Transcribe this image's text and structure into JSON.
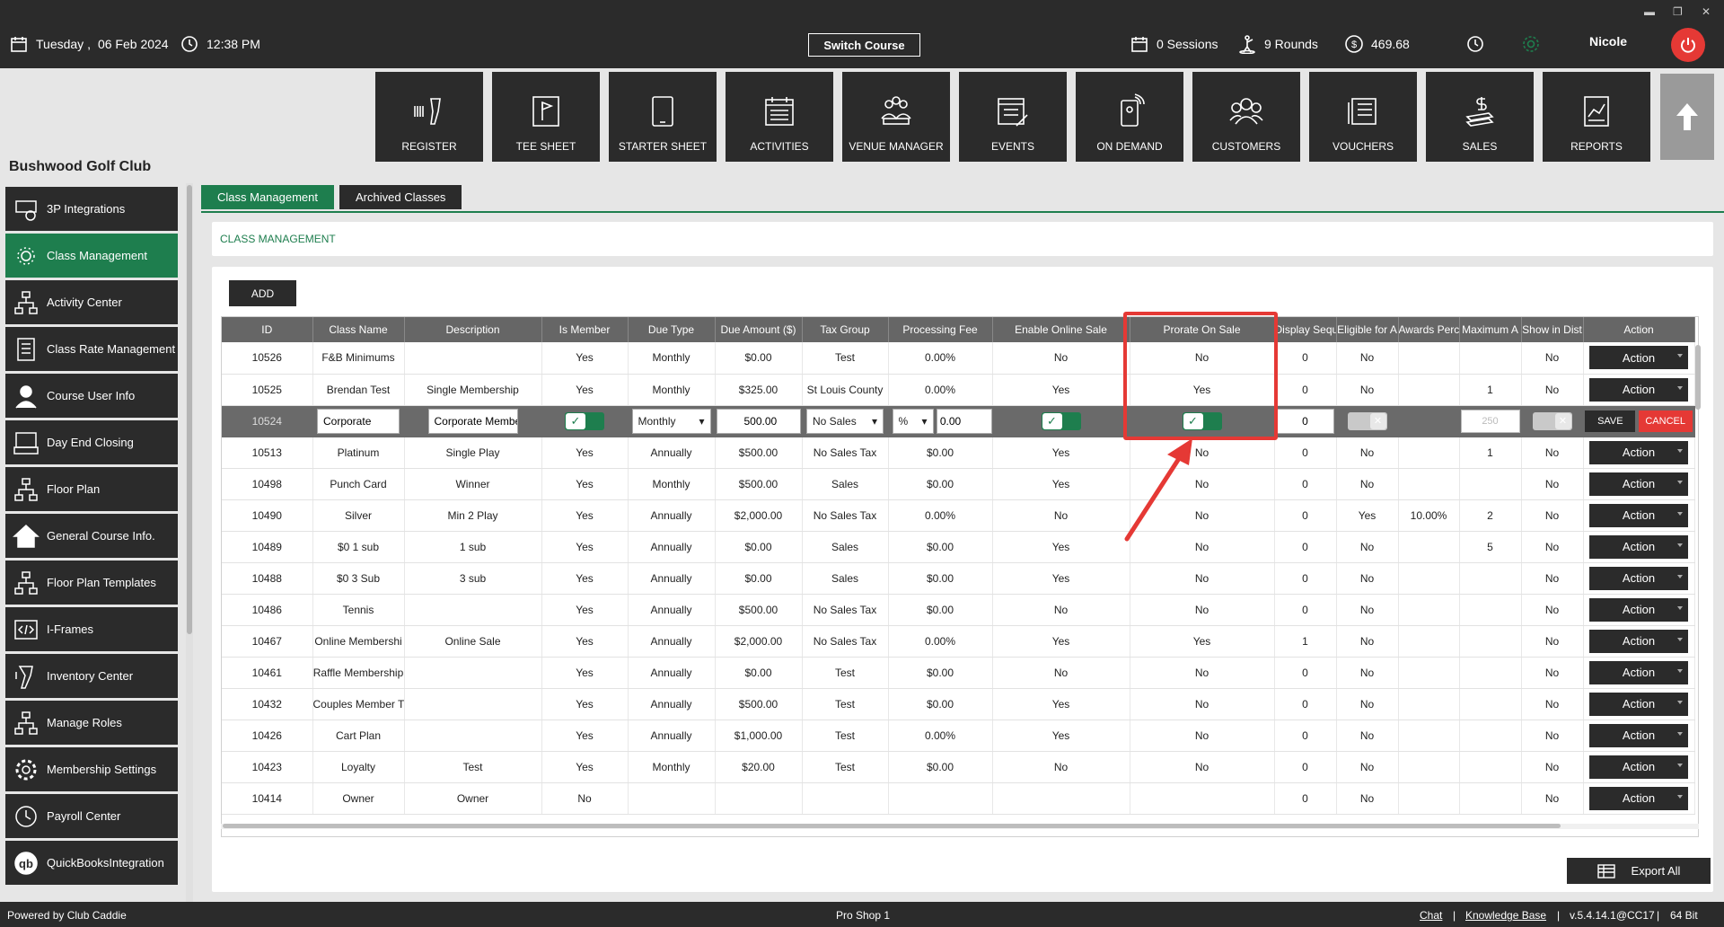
{
  "header": {
    "day": "Tuesday ,",
    "date": "06 Feb 2024",
    "time": "12:38 PM",
    "switch_course": "Switch Course",
    "sessions": "0 Sessions",
    "rounds": "9 Rounds",
    "balance": "469.68",
    "user": "Nicole"
  },
  "nav": [
    {
      "label": "REGISTER",
      "icon": "barcode-scanner-icon"
    },
    {
      "label": "TEE SHEET",
      "icon": "tee-sheet-icon"
    },
    {
      "label": "STARTER SHEET",
      "icon": "tablet-icon"
    },
    {
      "label": "ACTIVITIES",
      "icon": "calendar-list-icon"
    },
    {
      "label": "VENUE MANAGER",
      "icon": "venue-people-icon"
    },
    {
      "label": "EVENTS",
      "icon": "calendar-edit-icon"
    },
    {
      "label": "ON DEMAND",
      "icon": "phone-signal-icon"
    },
    {
      "label": "CUSTOMERS",
      "icon": "customers-icon"
    },
    {
      "label": "VOUCHERS",
      "icon": "voucher-icon"
    },
    {
      "label": "SALES",
      "icon": "money-stack-icon"
    },
    {
      "label": "REPORTS",
      "icon": "report-chart-icon"
    }
  ],
  "club_name": "Bushwood Golf Club",
  "sidebar": [
    {
      "label": "3P Integrations"
    },
    {
      "label": "Class Management"
    },
    {
      "label": "Activity  Center"
    },
    {
      "label": "Class Rate Management"
    },
    {
      "label": "Course User Info"
    },
    {
      "label": "Day End Closing"
    },
    {
      "label": "Floor Plan"
    },
    {
      "label": "General Course Info."
    },
    {
      "label": "Floor Plan Templates"
    },
    {
      "label": "I-Frames"
    },
    {
      "label": "Inventory Center"
    },
    {
      "label": "Manage Roles"
    },
    {
      "label": "Membership Settings"
    },
    {
      "label": "Payroll Center"
    },
    {
      "label": "QuickBooksIntegration"
    }
  ],
  "tabs": [
    {
      "label": "Class Management"
    },
    {
      "label": "Archived Classes"
    }
  ],
  "section_title": "CLASS MANAGEMENT",
  "add_label": "ADD",
  "columns": [
    "ID",
    "Class Name",
    "Description",
    "Is Member",
    "Due Type",
    "Due Amount ($)",
    "Tax Group",
    "Processing Fee",
    "Enable Online Sale",
    "Prorate On Sale",
    "Display Sequ",
    "Eligible for A",
    "Awards Perce",
    "Maximum A",
    "Show in Dist",
    "Action"
  ],
  "rows_before": [
    [
      "10526",
      "F&B Minimums",
      "",
      "Yes",
      "Monthly",
      "$0.00",
      "Test",
      "0.00%",
      "No",
      "No",
      "0",
      "No",
      "",
      "",
      "No"
    ],
    [
      "10525",
      "Brendan Test",
      "Single Membership",
      "Yes",
      "Monthly",
      "$325.00",
      "St Louis County",
      "0.00%",
      "Yes",
      "Yes",
      "0",
      "No",
      "",
      "1",
      "No"
    ]
  ],
  "edit_row": {
    "id": "10524",
    "class_name": "Corporate",
    "description": "Corporate Membe",
    "due_type": "Monthly",
    "due_amount": "500.00",
    "tax_group": "No Sales",
    "fee_unit": "%",
    "fee_value": "0.00",
    "display_seq": "0",
    "max_placeholder": "250",
    "save": "SAVE",
    "cancel": "CANCEL"
  },
  "rows_after": [
    [
      "10513",
      "Platinum",
      "Single Play",
      "Yes",
      "Annually",
      "$500.00",
      "No Sales Tax",
      "$0.00",
      "Yes",
      "No",
      "0",
      "No",
      "",
      "1",
      "No"
    ],
    [
      "10498",
      "Punch Card",
      "Winner",
      "Yes",
      "Monthly",
      "$500.00",
      "Sales",
      "$0.00",
      "Yes",
      "No",
      "0",
      "No",
      "",
      "",
      "No"
    ],
    [
      "10490",
      "Silver",
      "Min 2 Play",
      "Yes",
      "Annually",
      "$2,000.00",
      "No Sales Tax",
      "0.00%",
      "No",
      "No",
      "0",
      "Yes",
      "10.00%",
      "2",
      "No"
    ],
    [
      "10489",
      "$0 1 sub",
      "1 sub",
      "Yes",
      "Annually",
      "$0.00",
      "Sales",
      "$0.00",
      "Yes",
      "No",
      "0",
      "No",
      "",
      "5",
      "No"
    ],
    [
      "10488",
      "$0 3 Sub",
      "3 sub",
      "Yes",
      "Annually",
      "$0.00",
      "Sales",
      "$0.00",
      "Yes",
      "No",
      "0",
      "No",
      "",
      "",
      "No"
    ],
    [
      "10486",
      "Tennis",
      "",
      "Yes",
      "Annually",
      "$500.00",
      "No Sales Tax",
      "$0.00",
      "No",
      "No",
      "0",
      "No",
      "",
      "",
      "No"
    ],
    [
      "10467",
      "Online Membershi",
      "Online Sale",
      "Yes",
      "Annually",
      "$2,000.00",
      "No Sales Tax",
      "0.00%",
      "Yes",
      "Yes",
      "1",
      "No",
      "",
      "",
      "No"
    ],
    [
      "10461",
      "Raffle Membership",
      "",
      "Yes",
      "Annually",
      "$0.00",
      "Test",
      "$0.00",
      "No",
      "No",
      "0",
      "No",
      "",
      "",
      "No"
    ],
    [
      "10432",
      "Couples Member T",
      "",
      "Yes",
      "Annually",
      "$500.00",
      "Test",
      "$0.00",
      "Yes",
      "No",
      "0",
      "No",
      "",
      "",
      "No"
    ],
    [
      "10426",
      "Cart Plan",
      "",
      "Yes",
      "Annually",
      "$1,000.00",
      "Test",
      "0.00%",
      "Yes",
      "No",
      "0",
      "No",
      "",
      "",
      "No"
    ],
    [
      "10423",
      "Loyalty",
      "Test",
      "Yes",
      "Monthly",
      "$20.00",
      "Test",
      "$0.00",
      "No",
      "No",
      "0",
      "No",
      "",
      "",
      "No"
    ],
    [
      "10414",
      "Owner",
      "Owner",
      "No",
      "",
      "",
      "",
      "",
      "",
      "",
      "0",
      "No",
      "",
      "",
      "No"
    ]
  ],
  "action_label": "Action",
  "export_label": "Export All",
  "footer": {
    "powered": "Powered by Club Caddie",
    "station": "Pro Shop 1",
    "chat": "Chat",
    "kb": "Knowledge Base",
    "version": "v.5.4.14.1@CC17",
    "bits": "64 Bit"
  },
  "colors": {
    "brand_green": "#1e7e4e",
    "dark": "#2b2b2b",
    "highlight_red": "#e53935"
  }
}
